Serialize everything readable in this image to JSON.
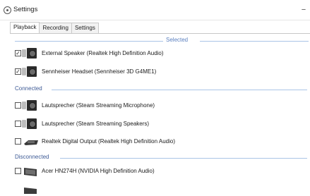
{
  "window": {
    "title": "Settings",
    "minimize_glyph": "−"
  },
  "tabs": [
    {
      "label": "Playback",
      "active": true
    },
    {
      "label": "Recording",
      "active": false
    },
    {
      "label": "Settings",
      "active": false
    }
  ],
  "groups": [
    {
      "header": "Selected",
      "devices": [
        {
          "name": "External Speaker (Realtek High Definition Audio)",
          "checked": true,
          "icon": "speaker-icon"
        },
        {
          "name": "Sennheiser Headset (Sennheiser 3D G4ME1)",
          "checked": true,
          "icon": "speaker-icon"
        }
      ]
    },
    {
      "header": "Connected",
      "devices": [
        {
          "name": "Lautsprecher (Steam Streaming Microphone)",
          "checked": false,
          "icon": "speaker-icon"
        },
        {
          "name": "Lautsprecher (Steam Streaming Speakers)",
          "checked": false,
          "icon": "speaker-icon"
        },
        {
          "name": "Realtek Digital Output (Realtek High Definition Audio)",
          "checked": false,
          "icon": "digital-output-icon"
        }
      ]
    },
    {
      "header": "Disconnected",
      "devices": [
        {
          "name": "Acer HN274H (NVIDIA High Definition Audio)",
          "checked": false,
          "icon": "monitor-icon"
        }
      ]
    }
  ],
  "colors": {
    "group_line": "#aac4e6",
    "group_text": "#3d5a95",
    "selected_text": "#5a7fbf"
  }
}
